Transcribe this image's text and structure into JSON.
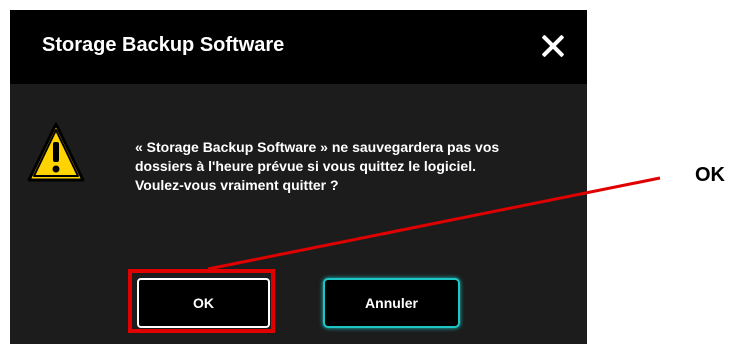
{
  "dialog": {
    "title": "Storage Backup Software",
    "message_lines": [
      "« Storage Backup Software » ne sauvegardera pas vos",
      "dossiers à l'heure prévue si vous quittez le logiciel.",
      "Voulez-vous vraiment quitter ?"
    ],
    "ok_label": "OK",
    "cancel_label": "Annuler",
    "icons": {
      "close": "close-icon",
      "warning": "warning-icon"
    }
  },
  "annotation": {
    "label": "OK",
    "color": "#e00000"
  },
  "colors": {
    "accent": "#1cc6c6",
    "titlebar": "#000000",
    "body": "#1c1c1c",
    "warning": "#ffd400"
  }
}
